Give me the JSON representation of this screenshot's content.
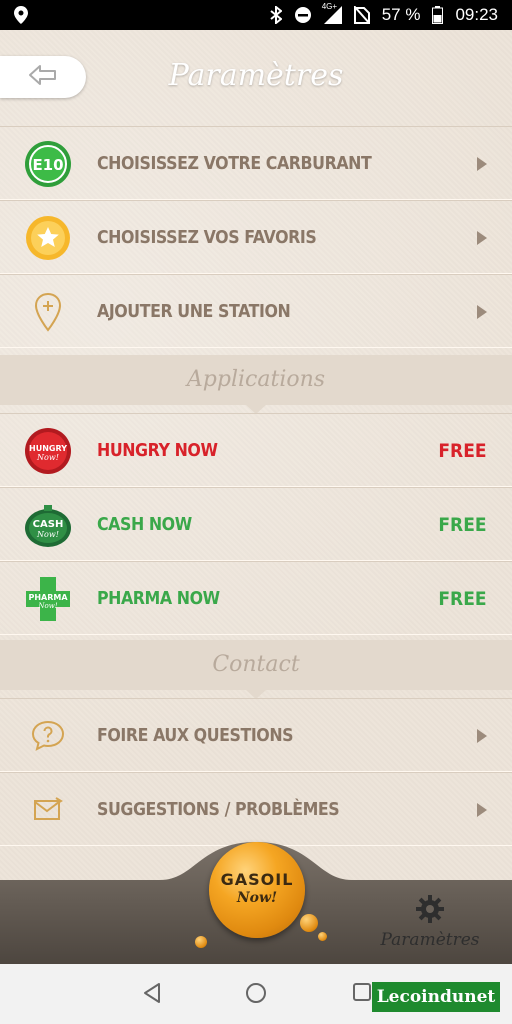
{
  "status_bar": {
    "network": "4G+",
    "battery": "57 %",
    "time": "09:23"
  },
  "header": {
    "title": "Paramètres",
    "back_icon": "arrow-left-icon"
  },
  "settings": [
    {
      "label": "CHOISISSEZ VOTRE CARBURANT",
      "icon": "e10-fuel-icon",
      "badge_text": "E10"
    },
    {
      "label": "CHOISISSEZ VOS FAVORIS",
      "icon": "star-icon"
    },
    {
      "label": "AJOUTER UNE STATION",
      "icon": "map-pin-add-icon"
    }
  ],
  "applications_section": "Applications",
  "applications": [
    {
      "label": "HUNGRY NOW",
      "price": "FREE",
      "color": "#d8222a",
      "icon": "hungry-now-logo",
      "logo_text": "HUNGRY"
    },
    {
      "label": "CASH NOW",
      "price": "FREE",
      "color": "#3aa84a",
      "icon": "cash-now-logo",
      "logo_text": "CASH"
    },
    {
      "label": "PHARMA NOW",
      "price": "FREE",
      "color": "#3aa84a",
      "icon": "pharma-now-logo",
      "logo_text": "PHARMA"
    }
  ],
  "contact_section": "Contact",
  "contact": [
    {
      "label": "FOIRE AUX QUESTIONS",
      "icon": "question-bubble-icon"
    },
    {
      "label": "SUGGESTIONS / PROBLÈMES",
      "icon": "mail-icon"
    }
  ],
  "bottom_bar": {
    "logo_line1": "GASOIL",
    "logo_line2": "Now!",
    "settings_tab": "Paramètres",
    "settings_icon": "gear-icon"
  },
  "nav_bar": {
    "icons": [
      "back-triangle-icon",
      "home-circle-icon",
      "recents-square-icon"
    ]
  },
  "watermark": "Lecoindunet",
  "colors": {
    "text_brown": "#8a7767",
    "red": "#d8222a",
    "green": "#3aa84a",
    "orange": "#f5a623"
  }
}
